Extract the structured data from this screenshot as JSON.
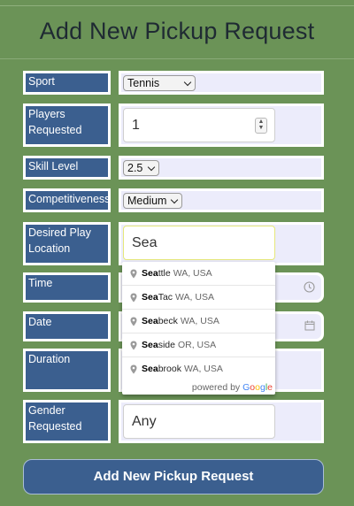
{
  "page": {
    "title": "Add New Pickup Request"
  },
  "form": {
    "sport": {
      "label": "Sport",
      "value": "Tennis"
    },
    "players": {
      "label": "Players Requested",
      "value": "1"
    },
    "skill": {
      "label": "Skill Level",
      "value": "2.5"
    },
    "competitiveness": {
      "label": "Competitiveness",
      "value": "Medium"
    },
    "location": {
      "label": "Desired Play Location",
      "value": "Sea"
    },
    "time": {
      "label": "Time"
    },
    "date": {
      "label": "Date"
    },
    "duration": {
      "label": "Duration"
    },
    "gender": {
      "label": "Gender Requested",
      "value": "Any"
    }
  },
  "autocomplete": {
    "suggestions": [
      {
        "match": "Sea",
        "rest": "ttle",
        "secondary": "WA, USA"
      },
      {
        "match": "Sea",
        "rest": "Tac",
        "secondary": "WA, USA"
      },
      {
        "match": "Sea",
        "rest": "beck",
        "secondary": "WA, USA"
      },
      {
        "match": "Sea",
        "rest": "side",
        "secondary": "OR, USA"
      },
      {
        "match": "Sea",
        "rest": "brook",
        "secondary": "WA, USA"
      }
    ],
    "powered_by": "powered by",
    "google": [
      "G",
      "o",
      "o",
      "g",
      "l",
      "e"
    ]
  },
  "submit_label": "Add New Pickup Request",
  "colors": {
    "background": "#6b9357",
    "label_bg": "#3b5f8f",
    "field_bg": "#ececfb"
  }
}
